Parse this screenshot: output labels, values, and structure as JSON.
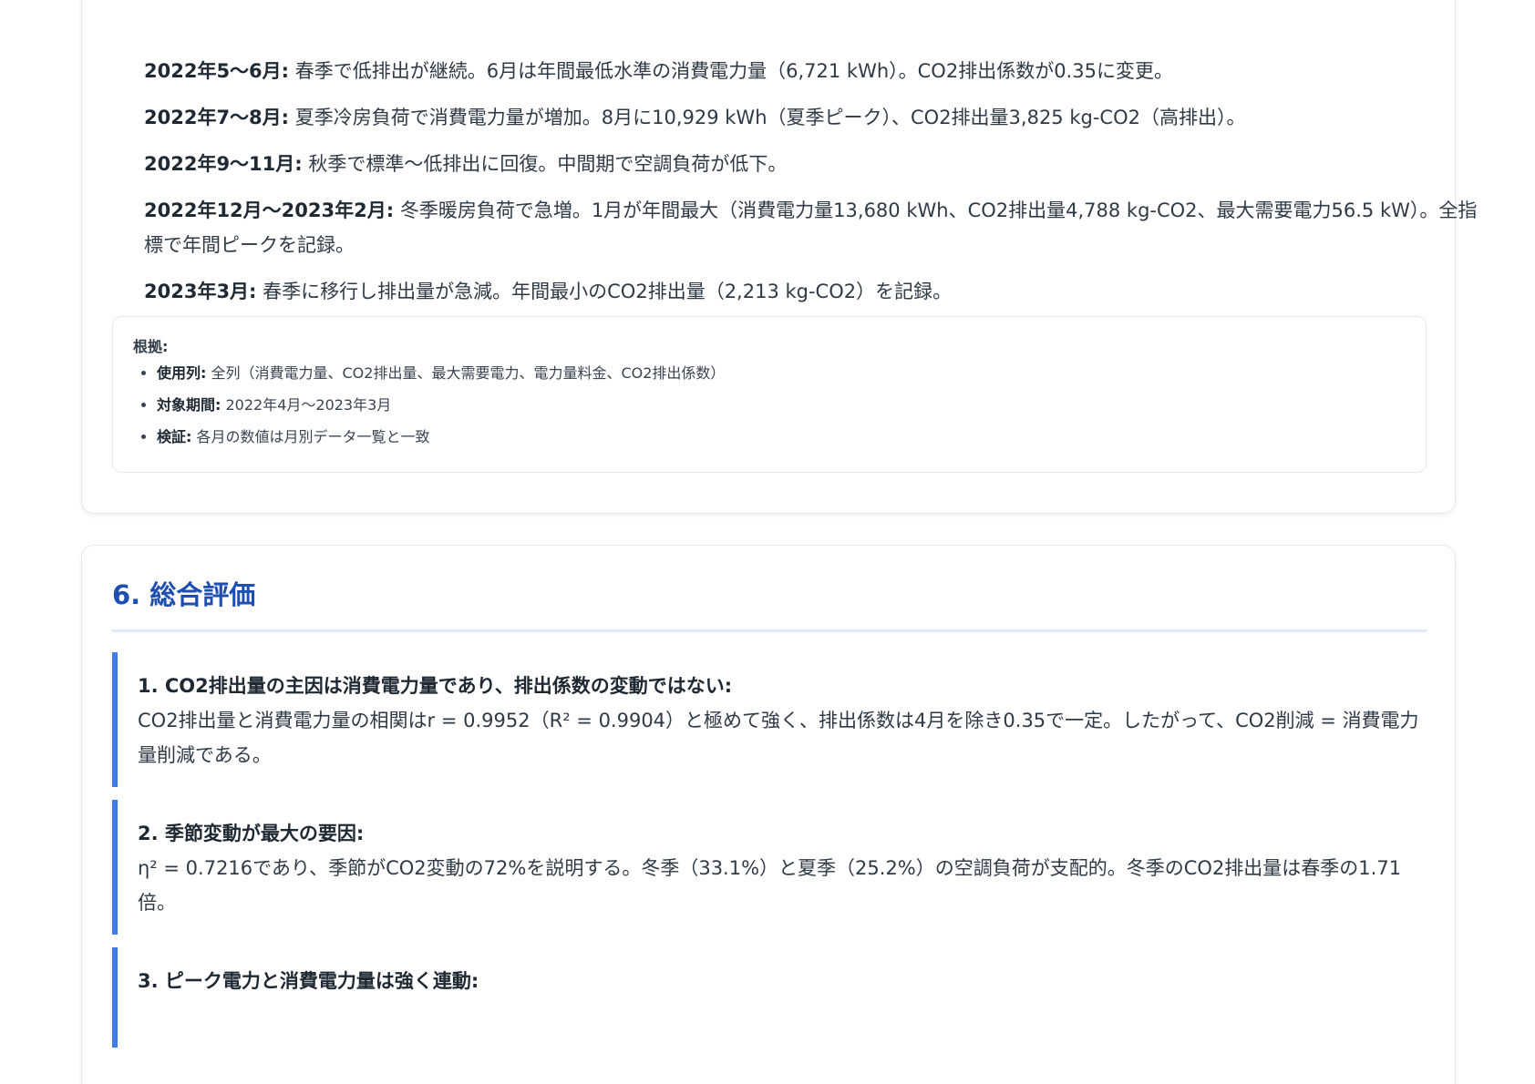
{
  "timeline": [
    {
      "label": "2022年5〜6月:",
      "text": " 春季で低排出が継続。6月は年間最低水準の消費電力量（6,721 kWh）。CO2排出係数が0.35に変更。"
    },
    {
      "label": "2022年7〜8月:",
      "text": " 夏季冷房負荷で消費電力量が増加。8月に10,929 kWh（夏季ピーク）、CO2排出量3,825 kg-CO2（高排出）。"
    },
    {
      "label": "2022年9〜11月:",
      "text": " 秋季で標準〜低排出に回復。中間期で空調負荷が低下。"
    },
    {
      "label": "2022年12月〜2023年2月:",
      "text": " 冬季暖房負荷で急増。1月が年間最大（消費電力量13,680 kWh、CO2排出量4,788 kg-CO2、最大需要電力56.5 kW）。全指標で年間ピークを記録。"
    },
    {
      "label": "2023年3月:",
      "text": " 春季に移行し排出量が急減。年間最小のCO2排出量（2,213 kg-CO2）を記録。"
    }
  ],
  "basis": {
    "title": "根拠:",
    "items": [
      {
        "label": "使用列:",
        "text": " 全列（消費電力量、CO2排出量、最大需要電力、電力量料金、CO2排出係数）"
      },
      {
        "label": "対象期間:",
        "text": " 2022年4月〜2023年3月"
      },
      {
        "label": "検証:",
        "text": " 各月の数値は月別データ一覧と一致"
      }
    ]
  },
  "section6": {
    "title": "6. 総合評価",
    "findings": [
      {
        "heading": "1. CO2排出量の主因は消費電力量であり、排出係数の変動ではない:",
        "body": "CO2排出量と消費電力量の相関はr = 0.9952（R² = 0.9904）と極めて強く、排出係数は4月を除き0.35で一定。したがって、CO2削減 = 消費電力量削減である。"
      },
      {
        "heading": "2. 季節変動が最大の要因:",
        "body": "η² = 0.7216であり、季節がCO2変動の72%を説明する。冬季（33.1%）と夏季（25.2%）の空調負荷が支配的。冬季のCO2排出量は春季の1.71倍。"
      },
      {
        "heading": "3. ピーク電力と消費電力量は強く連動:",
        "body": ""
      }
    ]
  },
  "colors": {
    "accent": "#1e4fb0",
    "finding_border": "#3f7ee8",
    "rule": "#dfe9f7"
  }
}
